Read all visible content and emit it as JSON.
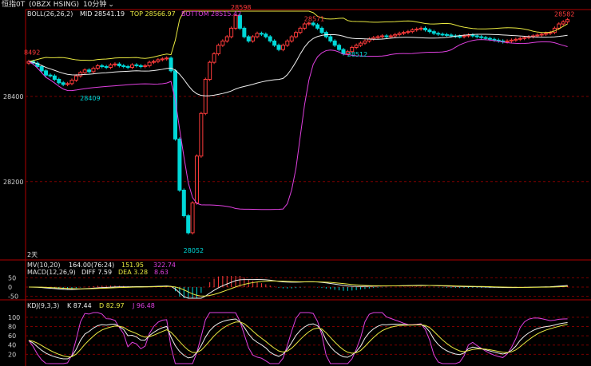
{
  "header": {
    "instrument": "恒指0T",
    "contract": "(0BZX HSING)",
    "period": "10分钟",
    "period_dropdown_icon": "chevron-down-icon"
  },
  "boll_legend": {
    "name": "BOLL(26,26,2)",
    "mid": "MID 28541.19",
    "top": "TOP 28566.97",
    "bottom": "BOTTOM 28515.42"
  },
  "mv_legend": {
    "name": "MV(10,20)",
    "v1": "164.00(76:24)",
    "v2": "151.95",
    "v3": "322.74"
  },
  "macd_legend": {
    "name": "MACD(12,26,9)",
    "diff": "DIFF 7.59",
    "dea": "DEA 3.28",
    "macd": "8.63"
  },
  "kdj_legend": {
    "name": "KDJ(9,3,3)",
    "k": "K 87.44",
    "d": "D 82.97",
    "j": "J 96.48"
  },
  "day_marker": "2天",
  "colors": {
    "up": "#ff3b3b",
    "down": "#00d8d8",
    "boll_mid": "#f0f0f0",
    "boll_top": "#e8e840",
    "boll_bottom": "#e040e0",
    "axis": "#b00000",
    "k": "#f0f0f0",
    "d": "#e8e840",
    "j": "#e040e0"
  },
  "chart_data": [
    {
      "type": "candlestick",
      "panel": "price",
      "ylim": [
        28020,
        28600
      ],
      "y_ticks": [
        28200,
        28400
      ],
      "annotations": [
        {
          "text": "8492",
          "value": 28492
        },
        {
          "text": "28409",
          "value": 28409
        },
        {
          "text": "28598",
          "value": 28598
        },
        {
          "text": "28052",
          "value": 28052
        },
        {
          "text": "28571",
          "value": 28571
        },
        {
          "text": "28512",
          "value": 28512
        },
        {
          "text": "28582",
          "value": 28582
        }
      ],
      "close": [
        28482,
        28478,
        28470,
        28460,
        28450,
        28448,
        28440,
        28432,
        28428,
        28430,
        28438,
        28448,
        28456,
        28462,
        28458,
        28466,
        28472,
        28470,
        28468,
        28474,
        28476,
        28472,
        28470,
        28468,
        28474,
        28472,
        28470,
        28472,
        28480,
        28482,
        28486,
        28488,
        28490,
        28460,
        28300,
        28180,
        28120,
        28080,
        28150,
        28260,
        28360,
        28440,
        28480,
        28500,
        28520,
        28530,
        28540,
        28560,
        28590,
        28560,
        28540,
        28530,
        28540,
        28548,
        28546,
        28540,
        28530,
        28520,
        28510,
        28520,
        28530,
        28540,
        28550,
        28560,
        28570,
        28572,
        28568,
        28560,
        28550,
        28540,
        28530,
        28520,
        28510,
        28500,
        28505,
        28515,
        28520,
        28525,
        28530,
        28535,
        28538,
        28540,
        28542,
        28540,
        28542,
        28545,
        28548,
        28550,
        28552,
        28556,
        28558,
        28560,
        28556,
        28552,
        28548,
        28546,
        28545,
        28544,
        28542,
        28541,
        28540,
        28542,
        28544,
        28542,
        28540,
        28538,
        28536,
        28534,
        28532,
        28530,
        28528,
        28530,
        28532,
        28534,
        28536,
        28538,
        28540,
        28542,
        28544,
        28546,
        28548,
        28550,
        28560,
        28570,
        28575,
        28580
      ]
    },
    {
      "type": "line",
      "panel": "macd",
      "ylim": [
        -60,
        60
      ],
      "y_ticks": [
        -50,
        0,
        50
      ]
    },
    {
      "type": "line",
      "panel": "kdj",
      "ylim": [
        0,
        110
      ],
      "y_ticks": [
        20,
        40,
        60,
        80,
        100
      ]
    }
  ]
}
